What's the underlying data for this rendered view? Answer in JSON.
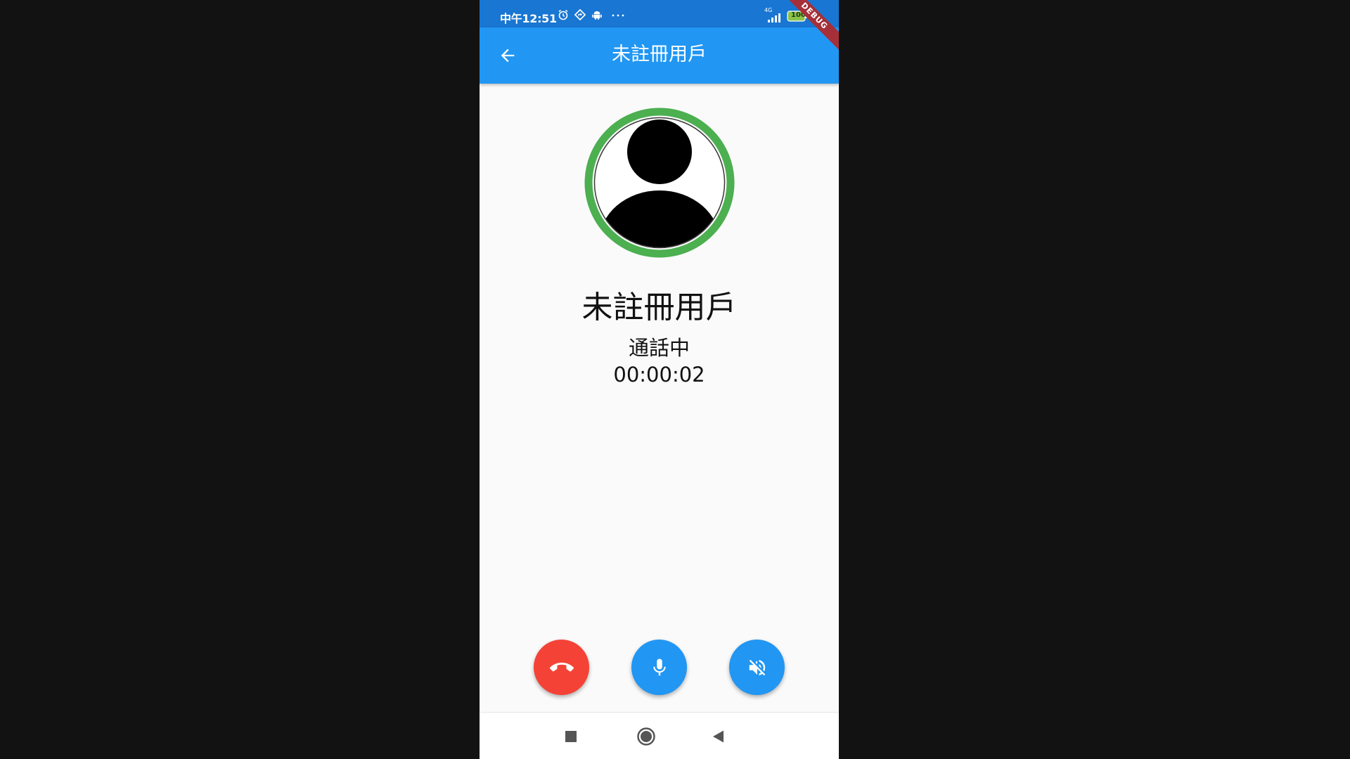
{
  "status_bar": {
    "time": "中午12:51",
    "network": "4G",
    "battery": "100"
  },
  "app_bar": {
    "title": "未註冊用戶",
    "debug_banner": "DEBUG"
  },
  "call": {
    "contact_name": "未註冊用戶",
    "status": "通話中",
    "timer": "00:00:02"
  },
  "colors": {
    "app_bar": "#2196f3",
    "status_bar": "#1976d2",
    "avatar_ring": "#4caf50",
    "hang_up": "#f44336",
    "action_blue": "#2196f3"
  },
  "icons": {
    "back": "arrow-back-icon",
    "hang_up": "call-end-icon",
    "mic": "mic-icon",
    "speaker": "volume-off-icon",
    "nav_recent": "square-icon",
    "nav_home": "circle-icon",
    "nav_back": "triangle-back-icon"
  }
}
